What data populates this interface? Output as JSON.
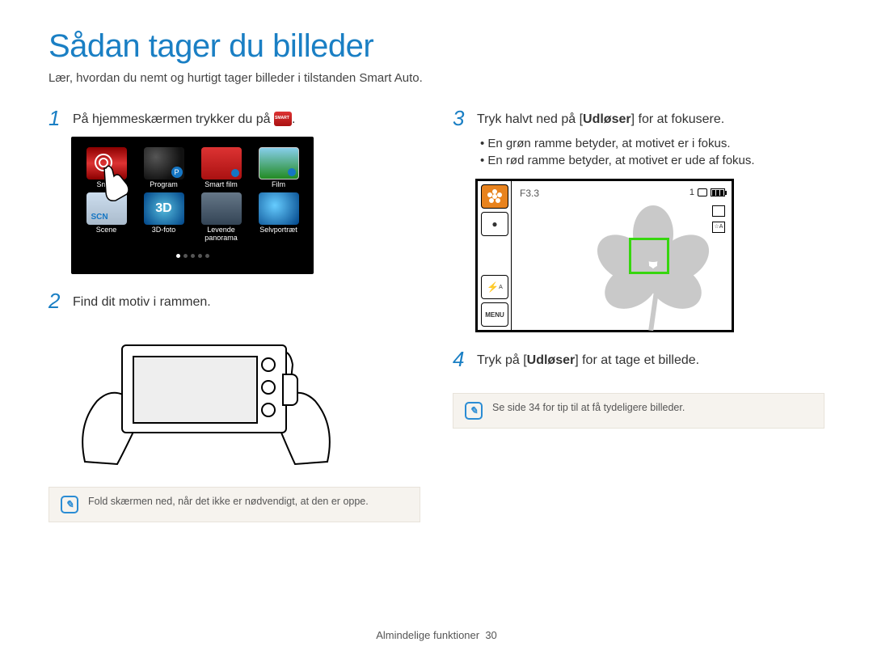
{
  "title": "Sådan tager du billeder",
  "subtitle": "Lær, hvordan du nemt og hurtigt tager billeder i tilstanden Smart Auto.",
  "steps": {
    "s1": {
      "num": "1",
      "text_before": "På hjemmeskærmen trykker du på ",
      "text_after": "."
    },
    "s2": {
      "num": "2",
      "text": "Find dit motiv i rammen."
    },
    "s3": {
      "num": "3",
      "text_before": "Tryk halvt ned på [",
      "bold": "Udløser",
      "text_after": "] for at fokusere."
    },
    "s4": {
      "num": "4",
      "text_before": "Tryk på [",
      "bold": "Udløser",
      "text_after": "] for at tage et billede."
    }
  },
  "bullets": {
    "b1": "En grøn ramme betyder, at motivet er i fokus.",
    "b2": "En rød ramme betyder, at motivet er ude af fokus."
  },
  "home_screen_items": [
    {
      "label": "Smart"
    },
    {
      "label": "Program"
    },
    {
      "label": "Smart film"
    },
    {
      "label": "Film"
    },
    {
      "label": "Scene"
    },
    {
      "label": "3D-foto"
    },
    {
      "label": "Levende panorama"
    },
    {
      "label": "Selvportræt"
    }
  ],
  "focus_preview": {
    "fnumber": "F3.3",
    "shots_remaining": "1",
    "flash_label": "A",
    "menu_label": "MENU"
  },
  "notes": {
    "left": "Fold skærmen ned, når det ikke er nødvendigt, at den er oppe.",
    "right": "Se side 34 for tip til at få tydeligere billeder."
  },
  "footer": {
    "section": "Almindelige funktioner",
    "page": "30"
  }
}
